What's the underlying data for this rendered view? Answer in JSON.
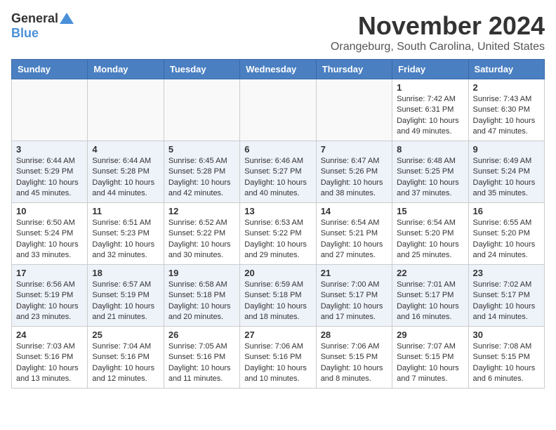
{
  "header": {
    "logo_general": "General",
    "logo_blue": "Blue",
    "month": "November 2024",
    "location": "Orangeburg, South Carolina, United States"
  },
  "days_of_week": [
    "Sunday",
    "Monday",
    "Tuesday",
    "Wednesday",
    "Thursday",
    "Friday",
    "Saturday"
  ],
  "weeks": [
    [
      {
        "day": "",
        "info": ""
      },
      {
        "day": "",
        "info": ""
      },
      {
        "day": "",
        "info": ""
      },
      {
        "day": "",
        "info": ""
      },
      {
        "day": "",
        "info": ""
      },
      {
        "day": "1",
        "info": "Sunrise: 7:42 AM\nSunset: 6:31 PM\nDaylight: 10 hours and 49 minutes."
      },
      {
        "day": "2",
        "info": "Sunrise: 7:43 AM\nSunset: 6:30 PM\nDaylight: 10 hours and 47 minutes."
      }
    ],
    [
      {
        "day": "3",
        "info": "Sunrise: 6:44 AM\nSunset: 5:29 PM\nDaylight: 10 hours and 45 minutes."
      },
      {
        "day": "4",
        "info": "Sunrise: 6:44 AM\nSunset: 5:28 PM\nDaylight: 10 hours and 44 minutes."
      },
      {
        "day": "5",
        "info": "Sunrise: 6:45 AM\nSunset: 5:28 PM\nDaylight: 10 hours and 42 minutes."
      },
      {
        "day": "6",
        "info": "Sunrise: 6:46 AM\nSunset: 5:27 PM\nDaylight: 10 hours and 40 minutes."
      },
      {
        "day": "7",
        "info": "Sunrise: 6:47 AM\nSunset: 5:26 PM\nDaylight: 10 hours and 38 minutes."
      },
      {
        "day": "8",
        "info": "Sunrise: 6:48 AM\nSunset: 5:25 PM\nDaylight: 10 hours and 37 minutes."
      },
      {
        "day": "9",
        "info": "Sunrise: 6:49 AM\nSunset: 5:24 PM\nDaylight: 10 hours and 35 minutes."
      }
    ],
    [
      {
        "day": "10",
        "info": "Sunrise: 6:50 AM\nSunset: 5:24 PM\nDaylight: 10 hours and 33 minutes."
      },
      {
        "day": "11",
        "info": "Sunrise: 6:51 AM\nSunset: 5:23 PM\nDaylight: 10 hours and 32 minutes."
      },
      {
        "day": "12",
        "info": "Sunrise: 6:52 AM\nSunset: 5:22 PM\nDaylight: 10 hours and 30 minutes."
      },
      {
        "day": "13",
        "info": "Sunrise: 6:53 AM\nSunset: 5:22 PM\nDaylight: 10 hours and 29 minutes."
      },
      {
        "day": "14",
        "info": "Sunrise: 6:54 AM\nSunset: 5:21 PM\nDaylight: 10 hours and 27 minutes."
      },
      {
        "day": "15",
        "info": "Sunrise: 6:54 AM\nSunset: 5:20 PM\nDaylight: 10 hours and 25 minutes."
      },
      {
        "day": "16",
        "info": "Sunrise: 6:55 AM\nSunset: 5:20 PM\nDaylight: 10 hours and 24 minutes."
      }
    ],
    [
      {
        "day": "17",
        "info": "Sunrise: 6:56 AM\nSunset: 5:19 PM\nDaylight: 10 hours and 23 minutes."
      },
      {
        "day": "18",
        "info": "Sunrise: 6:57 AM\nSunset: 5:19 PM\nDaylight: 10 hours and 21 minutes."
      },
      {
        "day": "19",
        "info": "Sunrise: 6:58 AM\nSunset: 5:18 PM\nDaylight: 10 hours and 20 minutes."
      },
      {
        "day": "20",
        "info": "Sunrise: 6:59 AM\nSunset: 5:18 PM\nDaylight: 10 hours and 18 minutes."
      },
      {
        "day": "21",
        "info": "Sunrise: 7:00 AM\nSunset: 5:17 PM\nDaylight: 10 hours and 17 minutes."
      },
      {
        "day": "22",
        "info": "Sunrise: 7:01 AM\nSunset: 5:17 PM\nDaylight: 10 hours and 16 minutes."
      },
      {
        "day": "23",
        "info": "Sunrise: 7:02 AM\nSunset: 5:17 PM\nDaylight: 10 hours and 14 minutes."
      }
    ],
    [
      {
        "day": "24",
        "info": "Sunrise: 7:03 AM\nSunset: 5:16 PM\nDaylight: 10 hours and 13 minutes."
      },
      {
        "day": "25",
        "info": "Sunrise: 7:04 AM\nSunset: 5:16 PM\nDaylight: 10 hours and 12 minutes."
      },
      {
        "day": "26",
        "info": "Sunrise: 7:05 AM\nSunset: 5:16 PM\nDaylight: 10 hours and 11 minutes."
      },
      {
        "day": "27",
        "info": "Sunrise: 7:06 AM\nSunset: 5:16 PM\nDaylight: 10 hours and 10 minutes."
      },
      {
        "day": "28",
        "info": "Sunrise: 7:06 AM\nSunset: 5:15 PM\nDaylight: 10 hours and 8 minutes."
      },
      {
        "day": "29",
        "info": "Sunrise: 7:07 AM\nSunset: 5:15 PM\nDaylight: 10 hours and 7 minutes."
      },
      {
        "day": "30",
        "info": "Sunrise: 7:08 AM\nSunset: 5:15 PM\nDaylight: 10 hours and 6 minutes."
      }
    ]
  ]
}
